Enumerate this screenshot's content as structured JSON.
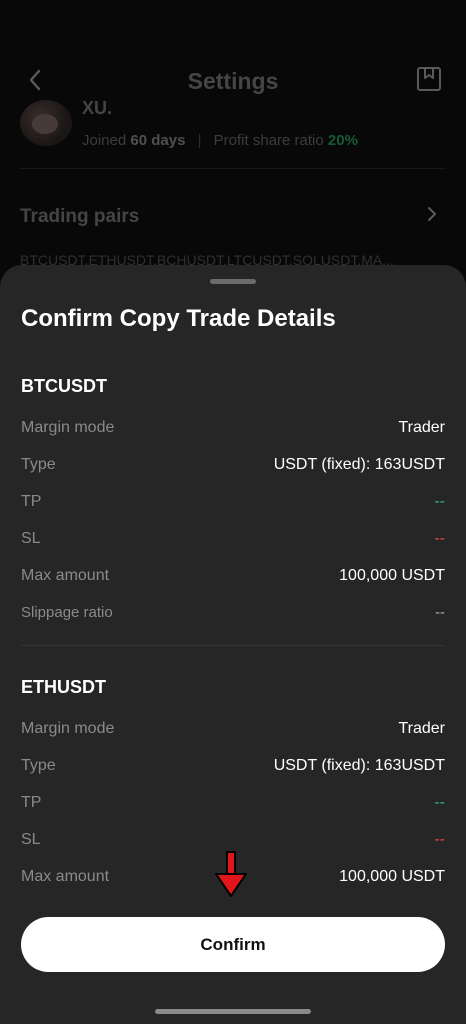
{
  "header": {
    "title": "Settings"
  },
  "profile": {
    "name": "XU.",
    "joined_label": "Joined",
    "joined_value": "60 days",
    "profit_label": "Profit share ratio",
    "profit_value": "20%"
  },
  "trading_pairs": {
    "title": "Trading pairs",
    "list": "BTCUSDT,ETHUSDT,BCHUSDT,LTCUSDT,SOLUSDT,MA..."
  },
  "sheet": {
    "title": "Confirm Copy Trade Details",
    "pairs": [
      {
        "name": "BTCUSDT",
        "rows": [
          {
            "label": "Margin mode",
            "value": "Trader"
          },
          {
            "label": "Type",
            "value": "USDT (fixed): 163USDT"
          },
          {
            "label": "TP",
            "value": "--"
          },
          {
            "label": "SL",
            "value": "--"
          },
          {
            "label": "Max amount",
            "value": "100,000 USDT"
          },
          {
            "label": "Slippage ratio",
            "value": "--"
          }
        ]
      },
      {
        "name": "ETHUSDT",
        "rows": [
          {
            "label": "Margin mode",
            "value": "Trader"
          },
          {
            "label": "Type",
            "value": "USDT (fixed): 163USDT"
          },
          {
            "label": "TP",
            "value": "--"
          },
          {
            "label": "SL",
            "value": "--"
          },
          {
            "label": "Max amount",
            "value": "100,000 USDT"
          }
        ]
      }
    ],
    "confirm_label": "Confirm"
  },
  "colors": {
    "tp": "#2fb673",
    "sl": "#e04545",
    "profit": "#1f8a4e",
    "annotation_arrow": "#e0161b"
  },
  "icons": [
    "back-arrow-icon",
    "book-icon",
    "chevron-right-icon",
    "annotation-down-arrow-icon"
  ]
}
